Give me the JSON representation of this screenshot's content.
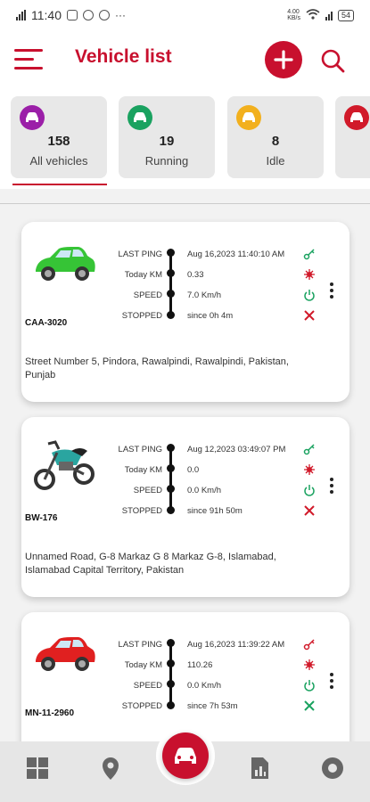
{
  "status_bar": {
    "time": "11:40",
    "net_speed": "4.00\nKB/s",
    "battery": "54"
  },
  "header": {
    "title": "Vehicle list"
  },
  "summary": [
    {
      "count": "158",
      "label": "All vehicles",
      "color": "#9b1fa8"
    },
    {
      "count": "19",
      "label": "Running",
      "color": "#1aa260"
    },
    {
      "count": "8",
      "label": "Idle",
      "color": "#f2b01e"
    },
    {
      "count": "",
      "label": "",
      "color": "#d11a2a"
    }
  ],
  "vehicles": [
    {
      "plate": "CAA-3020",
      "type": "car",
      "color": "#36c436",
      "rows": [
        {
          "key": "LAST PING",
          "value": "Aug 16,2023 11:40:10 AM",
          "status_icon": "key-icon",
          "status_color": "#1aa260"
        },
        {
          "key": "Today KM",
          "value": "0.33",
          "status_icon": "engine-icon",
          "status_color": "#d11a2a"
        },
        {
          "key": "SPEED",
          "value": "7.0 Km/h",
          "status_icon": "power-icon",
          "status_color": "#1aa260"
        },
        {
          "key": "STOPPED",
          "value": "since 0h 4m",
          "status_icon": "tools-icon",
          "status_color": "#d11a2a"
        }
      ],
      "address": "Street Number 5, Pindora, Rawalpindi, Rawalpindi, Pakistan, Punjab"
    },
    {
      "plate": "BW-176",
      "type": "bike",
      "color": "#2aa5a0",
      "rows": [
        {
          "key": "LAST PING",
          "value": "Aug 12,2023 03:49:07 PM",
          "status_icon": "key-icon",
          "status_color": "#1aa260"
        },
        {
          "key": "Today KM",
          "value": "0.0",
          "status_icon": "engine-icon",
          "status_color": "#d11a2a"
        },
        {
          "key": "SPEED",
          "value": "0.0 Km/h",
          "status_icon": "power-icon",
          "status_color": "#1aa260"
        },
        {
          "key": "STOPPED",
          "value": "since 91h 50m",
          "status_icon": "tools-icon",
          "status_color": "#d11a2a"
        }
      ],
      "address": "Unnamed Road, G-8 Markaz G 8 Markaz G-8, Islamabad, Islamabad Capital Territory, Pakistan"
    },
    {
      "plate": "MN-11-2960",
      "type": "car",
      "color": "#e02020",
      "rows": [
        {
          "key": "LAST PING",
          "value": "Aug 16,2023 11:39:22 AM",
          "status_icon": "key-icon",
          "status_color": "#d11a2a"
        },
        {
          "key": "Today KM",
          "value": "110.26",
          "status_icon": "engine-icon",
          "status_color": "#d11a2a"
        },
        {
          "key": "SPEED",
          "value": "0.0 Km/h",
          "status_icon": "power-icon",
          "status_color": "#1aa260"
        },
        {
          "key": "STOPPED",
          "value": "since 7h 53m",
          "status_icon": "tools-icon",
          "status_color": "#1aa260"
        }
      ],
      "address": ""
    }
  ],
  "bottom_nav": [
    "dashboard-icon",
    "location-icon",
    "vehicles-icon",
    "reports-icon",
    "settings-icon"
  ]
}
